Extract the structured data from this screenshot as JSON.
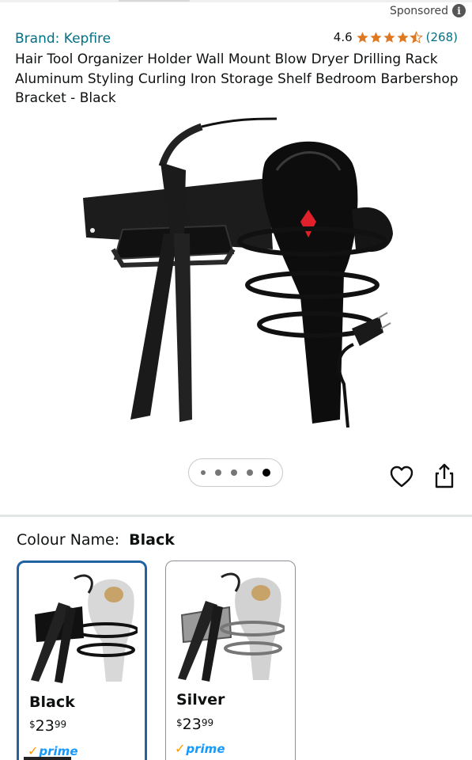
{
  "header": {
    "sponsored_label": "Sponsored",
    "info_icon": "info-icon"
  },
  "product": {
    "brand": "Brand: Kepfire",
    "rating_value": "4.6",
    "rating_stars": 4.5,
    "rating_count": "(268)",
    "title": "Hair Tool Organizer Holder Wall Mount Blow Dryer Drilling Rack Aluminum Styling Curling Iron Storage Shelf Bedroom Barbershop Bracket - Black"
  },
  "carousel": {
    "total": 5,
    "active_index": 4
  },
  "actions": {
    "favorite_icon": "heart-icon",
    "share_icon": "share-icon"
  },
  "variant": {
    "label": "Colour Name:",
    "selected": "Black",
    "options": [
      {
        "name": "Black",
        "price_symbol": "$",
        "price_whole": "23",
        "price_fraction": "99",
        "prime_label": "prime"
      },
      {
        "name": "Silver",
        "price_symbol": "$",
        "price_whole": "23",
        "price_fraction": "99",
        "prime_label": "prime"
      }
    ]
  },
  "colors": {
    "link": "#007185",
    "star": "#de7921",
    "selected_border": "#2162a1",
    "prime_blue": "#1399ff",
    "prime_check": "#ff9900"
  }
}
